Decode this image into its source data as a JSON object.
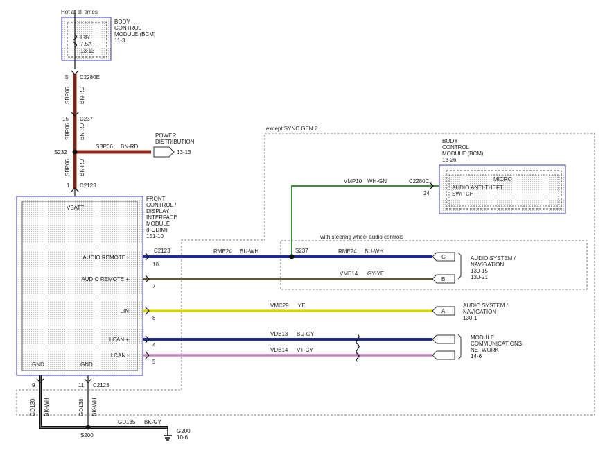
{
  "header": {
    "hot": "Hot at all times"
  },
  "bcm_top": {
    "title": [
      "BODY",
      "CONTROL",
      "MODULE (BCM)",
      "11-3"
    ],
    "fuse": [
      "F87",
      "7.5A",
      "13-13"
    ]
  },
  "connectors": {
    "c2280e": "C2280E",
    "c2280e_pin": "5",
    "c237": "C237",
    "c237_pin": "15",
    "s232": "S232",
    "c2123_top": "C2123",
    "c2123_top_pin": "1",
    "c2123_right": "C2123",
    "c2123_bottom": "C2123",
    "gnd_pin1": "9",
    "gnd_pin2": "11",
    "c2280c": "C2280C",
    "c2280c_pin": "24",
    "s237": "S237",
    "s200": "S200"
  },
  "wires": {
    "sbp06": "SBP06",
    "bnrd": "BN-RD",
    "vmp10": "VMP10",
    "whgn": "WH-GN",
    "rme24": "RME24",
    "buwh": "BU-WH",
    "vme14": "VME14",
    "gyye": "GY-YE",
    "vmc29": "VMC29",
    "ye": "YE",
    "vdb13": "VDB13",
    "bugy": "BU-GY",
    "vdb14": "VDB14",
    "vtgy": "VT-GY",
    "gd130": "GD130",
    "gd138": "GD138",
    "gd135": "GD135",
    "bkwh": "BK-WH",
    "bkgy": "BK-GY"
  },
  "power_dist": {
    "title": [
      "POWER",
      "DISTRIBUTION"
    ],
    "ref": "13-13"
  },
  "fcdim": {
    "vbatt": "VBATT",
    "label": [
      "FRONT",
      "CONTROL /",
      "DISPLAY",
      "INTERFACE",
      "MODULE",
      "(FCDIM)",
      "151-10"
    ],
    "pins": [
      "AUDIO REMOTE -",
      "AUDIO REMOTE +",
      "LIN",
      "I CAN +",
      "I CAN -"
    ],
    "pin_nums": [
      "10",
      "7",
      "8",
      "4",
      "5"
    ],
    "gnd": "GND"
  },
  "except_sync": "except SYNC GEN 2",
  "bcm_right": {
    "title": [
      "BODY",
      "CONTROL",
      "MODULE (BCM)",
      "13-26"
    ],
    "micro": "MICRO",
    "inner": [
      "AUDIO ANTI-THEFT",
      "SWITCH"
    ]
  },
  "steering": "with steering wheel audio controls",
  "targets": {
    "c": "C",
    "b": "B",
    "a": "A",
    "audio_nav": [
      "AUDIO SYSTEM /",
      "NAVIGATION",
      "130-15",
      "130-21"
    ],
    "audio_nav2": [
      "AUDIO SYSTEM /",
      "NAVIGATION",
      "130-1"
    ],
    "mcn": [
      "MODULE",
      "COMMUNICATIONS",
      "NETWORK",
      "14-6"
    ]
  },
  "ground": {
    "g200": "G200",
    "ref": "10-6"
  },
  "colors": {
    "brown_red": "#8B2A1A",
    "blue": "#1E2DA8",
    "olive": "#6E6A4E",
    "yellow": "#F2EE1C",
    "pink": "#E09AD8",
    "green": "#3E8F3E",
    "black": "#111111"
  }
}
